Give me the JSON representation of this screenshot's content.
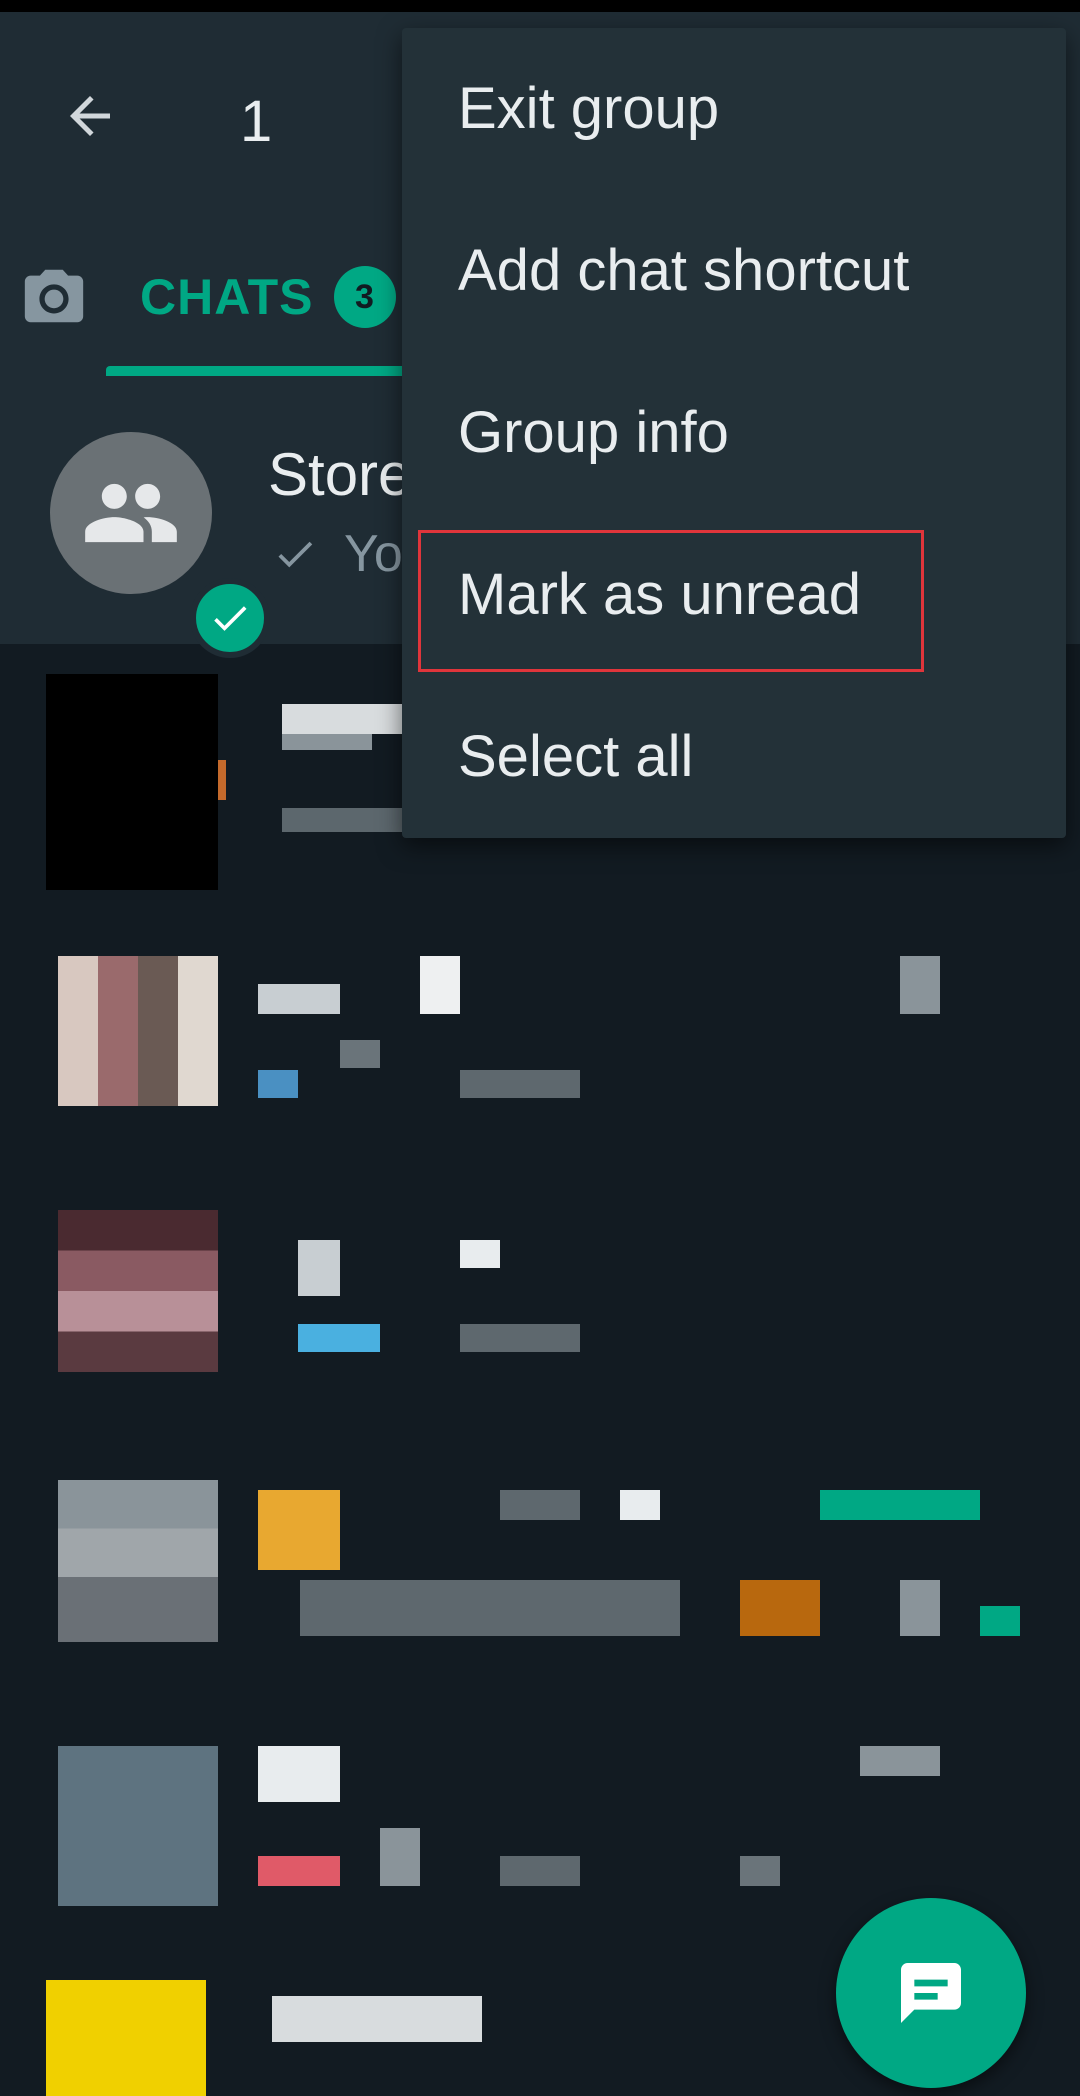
{
  "app_bar": {
    "selected_count": "1"
  },
  "tabs": {
    "chats_label": "CHATS",
    "chats_badge": "3"
  },
  "selected_chat": {
    "name": "Store",
    "preview": "Yo"
  },
  "menu": {
    "items": [
      {
        "label": "Exit group"
      },
      {
        "label": "Add chat shortcut"
      },
      {
        "label": "Group info"
      },
      {
        "label": "Mark as unread"
      },
      {
        "label": "Select all"
      }
    ]
  },
  "icons": {
    "back": "arrow-back-icon",
    "camera": "camera-icon",
    "group_avatar": "group-icon",
    "selected_check": "check-icon",
    "sent_tick": "single-tick-icon",
    "new_chat": "new-chat-icon"
  },
  "colors": {
    "accent": "#00a884",
    "app_bar": "#1f2c34",
    "background": "#121b22",
    "menu": "#233138",
    "highlight": "#e0353b"
  }
}
